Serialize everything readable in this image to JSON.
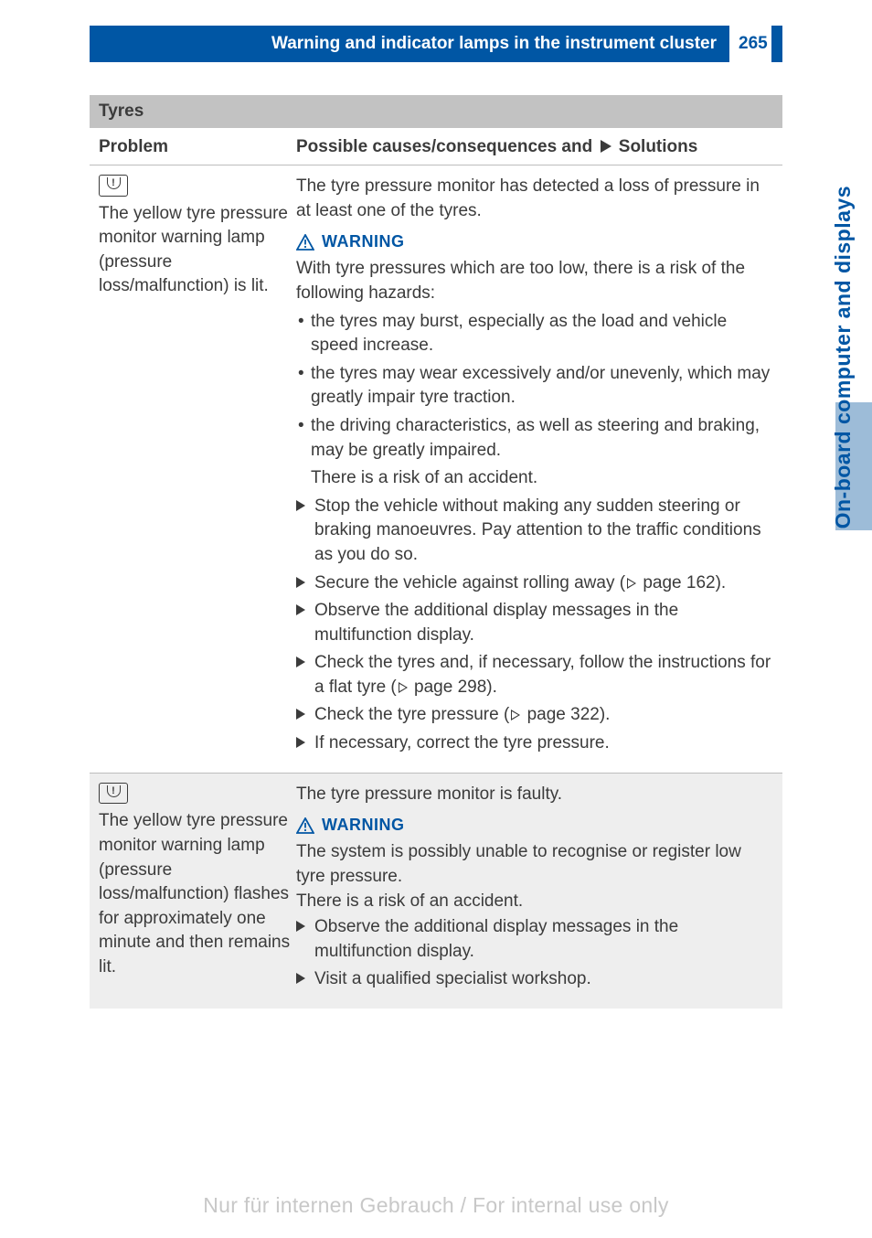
{
  "header": {
    "title": "Warning and indicator lamps in the instrument cluster",
    "page_number": "265"
  },
  "side_tab": "On-board computer and displays",
  "section_title": "Tyres",
  "table_header": {
    "problem": "Problem",
    "solutions_prefix": "Possible causes/consequences and",
    "solutions_suffix": "Solutions"
  },
  "row1": {
    "problem": "The yellow tyre pressure monitor warning lamp (pressure loss/malfunction) is lit.",
    "intro": "The tyre pressure monitor has detected a loss of pressure in at least one of the tyres.",
    "warning_label": "WARNING",
    "warning_text": "With tyre pressures which are too low, there is a risk of the following hazards:",
    "bullets": [
      "the tyres may burst, especially as the load and vehicle speed increase.",
      "the tyres may wear excessively and/or unevenly, which may greatly impair tyre traction.",
      "the driving characteristics, as well as steering and braking, may be greatly impaired."
    ],
    "after_bullets": "There is a risk of an accident.",
    "actions": {
      "a1": "Stop the vehicle without making any sudden steering or braking manoeuvres. Pay attention to the traffic conditions as you do so.",
      "a2_pre": "Secure the vehicle against rolling away (",
      "a2_page": " page 162).",
      "a3": "Observe the additional display messages in the multifunction display.",
      "a4_pre": "Check the tyres and, if necessary, follow the instructions for a flat tyre (",
      "a4_page": " page 298).",
      "a5_pre": "Check the tyre pressure (",
      "a5_page": " page 322).",
      "a6": "If necessary, correct the tyre pressure."
    }
  },
  "row2": {
    "problem": "The yellow tyre pressure monitor warning lamp (pressure loss/malfunction) flashes for approximately one minute and then remains lit.",
    "intro": "The tyre pressure monitor is faulty.",
    "warning_label": "WARNING",
    "warning_text1": "The system is possibly unable to recognise or register low tyre pressure.",
    "warning_text2": "There is a risk of an accident.",
    "actions": {
      "a1": "Observe the additional display messages in the multifunction display.",
      "a2": "Visit a qualified specialist workshop."
    }
  },
  "footer": "Nur für internen Gebrauch / For internal use only"
}
